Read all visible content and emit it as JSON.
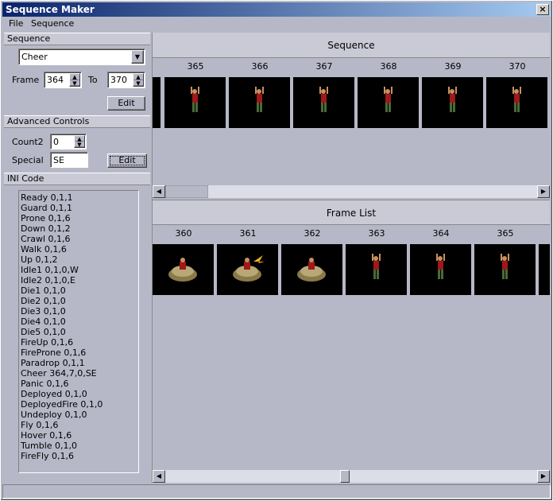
{
  "window": {
    "title": "Sequence Maker",
    "close_label": "×"
  },
  "menu": {
    "items": [
      "File",
      "Sequence"
    ]
  },
  "sequence_panel": {
    "heading": "Sequence",
    "selected": "Cheer",
    "frame_label": "Frame",
    "frame_from": "364",
    "to_label": "To",
    "frame_to": "370",
    "edit_label": "Edit"
  },
  "advanced_panel": {
    "heading": "Advanced Controls",
    "count2_label": "Count2",
    "count2_value": "0",
    "special_label": "Special",
    "special_value": "SE",
    "edit_label": "Edit"
  },
  "ini_panel": {
    "heading": "INI Code",
    "lines": [
      "Ready 0,1,1",
      "Guard 0,1,1",
      "Prone 0,1,6",
      "Down 0,1,2",
      "Crawl 0,1,6",
      "Walk 0,1,6",
      "Up 0,1,2",
      "Idle1 0,1,0,W",
      "Idle2 0,1,0,E",
      "Die1 0,1,0",
      "Die2 0,1,0",
      "Die3 0,1,0",
      "Die4 0,1,0",
      "Die5 0,1,0",
      "FireUp 0,1,6",
      "FireProne 0,1,6",
      "Paradrop 0,1,1",
      "Cheer 364,7,0,SE",
      "Panic 0,1,6",
      "Deployed 0,1,0",
      "DeployedFire 0,1,0",
      "Undeploy 0,1,0",
      "Fly 0,1,6",
      "Hover 0,1,6",
      "Tumble 0,1,0",
      "FireFly 0,1,6"
    ]
  },
  "sequence_view": {
    "heading": "Sequence",
    "frames": [
      "365",
      "366",
      "367",
      "368",
      "369",
      "370"
    ]
  },
  "frame_list": {
    "heading": "Frame List",
    "frames": [
      "360",
      "361",
      "362",
      "363",
      "364",
      "365"
    ]
  }
}
